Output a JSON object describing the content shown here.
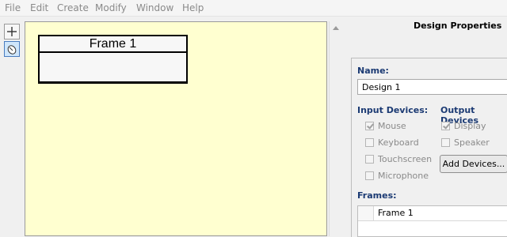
{
  "menu": [
    "File",
    "Edit",
    "Create",
    "Modify",
    "Window",
    "Help"
  ],
  "toolbar": {
    "add_icon": "plus-icon",
    "pointer_icon": "pointer-tool-icon"
  },
  "canvas": {
    "background": "#ffffd0",
    "frame_title": "Frame 1"
  },
  "properties": {
    "title": "Design Properties",
    "name_label": "Name:",
    "name_value": "Design 1",
    "input_devices_label": "Input Devices:",
    "output_devices_label": "Output Devices",
    "input_devices": [
      {
        "label": "Mouse",
        "checked": true
      },
      {
        "label": "Keyboard",
        "checked": false
      },
      {
        "label": "Touchscreen",
        "checked": false
      },
      {
        "label": "Microphone",
        "checked": false
      }
    ],
    "output_devices": [
      {
        "label": "Display",
        "checked": true
      },
      {
        "label": "Speaker",
        "checked": false
      }
    ],
    "add_devices_label": "Add Devices...",
    "frames_label": "Frames:",
    "frames": [
      "Frame 1"
    ]
  }
}
